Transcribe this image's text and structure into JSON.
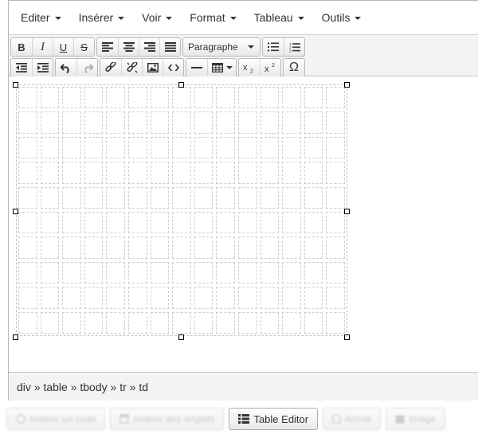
{
  "menubar": {
    "items": [
      {
        "label": "Editer"
      },
      {
        "label": "Insérer"
      },
      {
        "label": "Voir"
      },
      {
        "label": "Format"
      },
      {
        "label": "Tableau"
      },
      {
        "label": "Outils"
      }
    ]
  },
  "toolbar": {
    "bold_label": "B",
    "italic_label": "I",
    "underline_label": "U",
    "strike_label": "S",
    "format_select_value": "Paragraphe",
    "omega_label": "Ω"
  },
  "statusbar": {
    "path": "div » table » tbody » tr » td"
  },
  "bottom_buttons": {
    "insert_code": "Insérer un code",
    "insert_tabs": "Insérer des onglets",
    "table_editor": "Table Editor",
    "article": "Article",
    "image": "Image"
  }
}
